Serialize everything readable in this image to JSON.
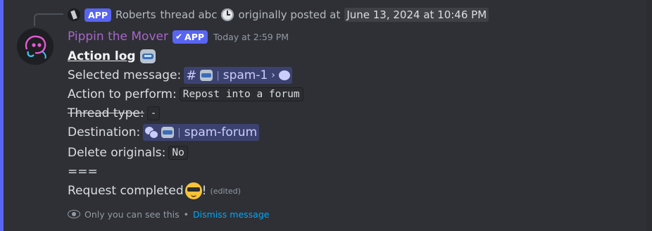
{
  "reply": {
    "app_tag": "APP",
    "author": "Roberts",
    "thread_name": "thread abc",
    "originally_posted": "originally posted at",
    "timestamp": "June 13, 2024 at 10:46 PM"
  },
  "message": {
    "author": "Pippin the Mover",
    "badge": "APP",
    "timestamp": "Today at 2:59 PM",
    "title": "Action log",
    "selected_label": "Selected message:",
    "selected_channel": "spam-1",
    "action_label": "Action to perform:",
    "action_value": "Repost into a forum",
    "thread_type_label": "Thread type:",
    "thread_type_value": "-",
    "destination_label": "Destination:",
    "destination_channel": "spam-forum",
    "delete_label": "Delete originals:",
    "delete_value": "No",
    "separator": "===",
    "completed": "Request completed",
    "exclaim": "!",
    "edited": "(edited)"
  },
  "footer": {
    "only_you": "Only you can see this",
    "bullet": "•",
    "dismiss": "Dismiss message"
  },
  "colors": {
    "author": "#a865c9",
    "accent": "#5865f2",
    "mention_bg": "#3c4270",
    "link": "#00a8fc"
  },
  "icons": [
    "clock-icon",
    "robot-icon",
    "hash-icon",
    "thread-bubble-icon",
    "forum-icon",
    "sunglasses-emoji",
    "eye-icon",
    "check-icon"
  ]
}
